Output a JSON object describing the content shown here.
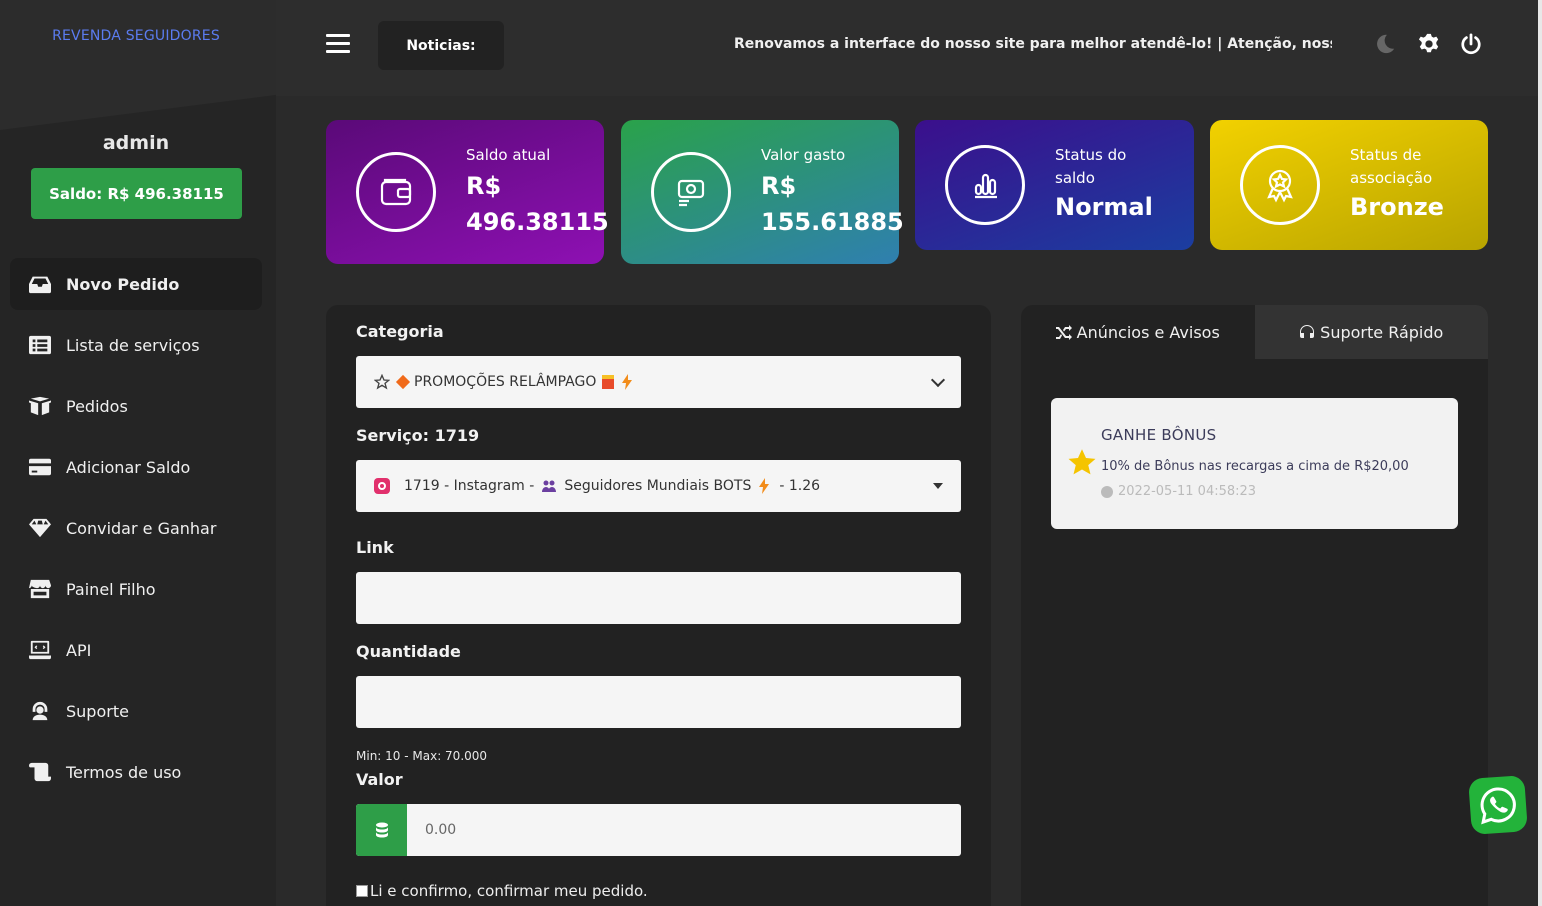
{
  "sidebar": {
    "brand": "REVENDA SEGUIDORES",
    "username": "admin",
    "balance_label": "Saldo: R$ 496.38115",
    "items": [
      {
        "label": "Novo Pedido",
        "icon": "inbox-icon",
        "active": true
      },
      {
        "label": "Lista de serviços",
        "icon": "list-icon"
      },
      {
        "label": "Pedidos",
        "icon": "boxes-icon"
      },
      {
        "label": "Adicionar Saldo",
        "icon": "credit-card-icon"
      },
      {
        "label": "Convidar e Ganhar",
        "icon": "diamond-icon"
      },
      {
        "label": "Painel Filho",
        "icon": "store-icon"
      },
      {
        "label": "API",
        "icon": "laptop-code-icon"
      },
      {
        "label": "Suporte",
        "icon": "headset-icon"
      },
      {
        "label": "Termos de uso",
        "icon": "scroll-icon"
      }
    ]
  },
  "topbar": {
    "news_label": "Noticias:",
    "ticker": "Renovamos a interface do nosso site para melhor atendê-lo! | Atenção, nossos",
    "icons": [
      "moon-icon",
      "gear-icon",
      "power-icon"
    ]
  },
  "cards": [
    {
      "label": "Saldo atual",
      "value_line1": "R$",
      "value_line2": "496.38115",
      "icon": "wallet-icon",
      "color_from": "#5a0a78",
      "color_to": "#8e10b3"
    },
    {
      "label": "Valor gasto",
      "value_line1": "R$",
      "value_line2": "155.61885",
      "icon": "money-icon",
      "color_from": "#2aa24a",
      "color_to": "#2f7fb0"
    },
    {
      "label_line1": "Status do",
      "label_line2": "saldo",
      "value": "Normal",
      "icon": "chart-icon",
      "color_from": "#3b0f8c",
      "color_to": "#1b3ea0"
    },
    {
      "label_line1": "Status de",
      "label_line2": "associação",
      "value": "Bronze",
      "icon": "award-icon",
      "color_from": "#f2d100",
      "color_to": "#b8a400"
    }
  ],
  "form": {
    "category_label": "Categoria",
    "category_value": "PROMOÇÕES RELÂMPAGO",
    "service_label": "Serviço: 1719",
    "service_value_a": "1719 - Instagram -",
    "service_value_b": "Seguidores Mundiais BOTS",
    "service_value_c": "- 1.26",
    "link_label": "Link",
    "link_value": "",
    "quantity_label": "Quantidade",
    "quantity_value": "",
    "minmax": "Min: 10 - Max: 70.000",
    "valor_label": "Valor",
    "valor_value": "0.00",
    "confirm_label": "Li e confirmo, confirmar meu pedido."
  },
  "announcements": {
    "tab_active": "Anúncios e Avisos",
    "tab_inactive": "Suporte Rápido",
    "notice": {
      "title": "GANHE BÔNUS",
      "text": "10% de Bônus nas recargas a cima de R$20,00",
      "date": "2022-05-11 04:58:23"
    }
  },
  "colors": {
    "accent_green": "#2e9e48",
    "brand_blue": "#5b7cf0"
  }
}
